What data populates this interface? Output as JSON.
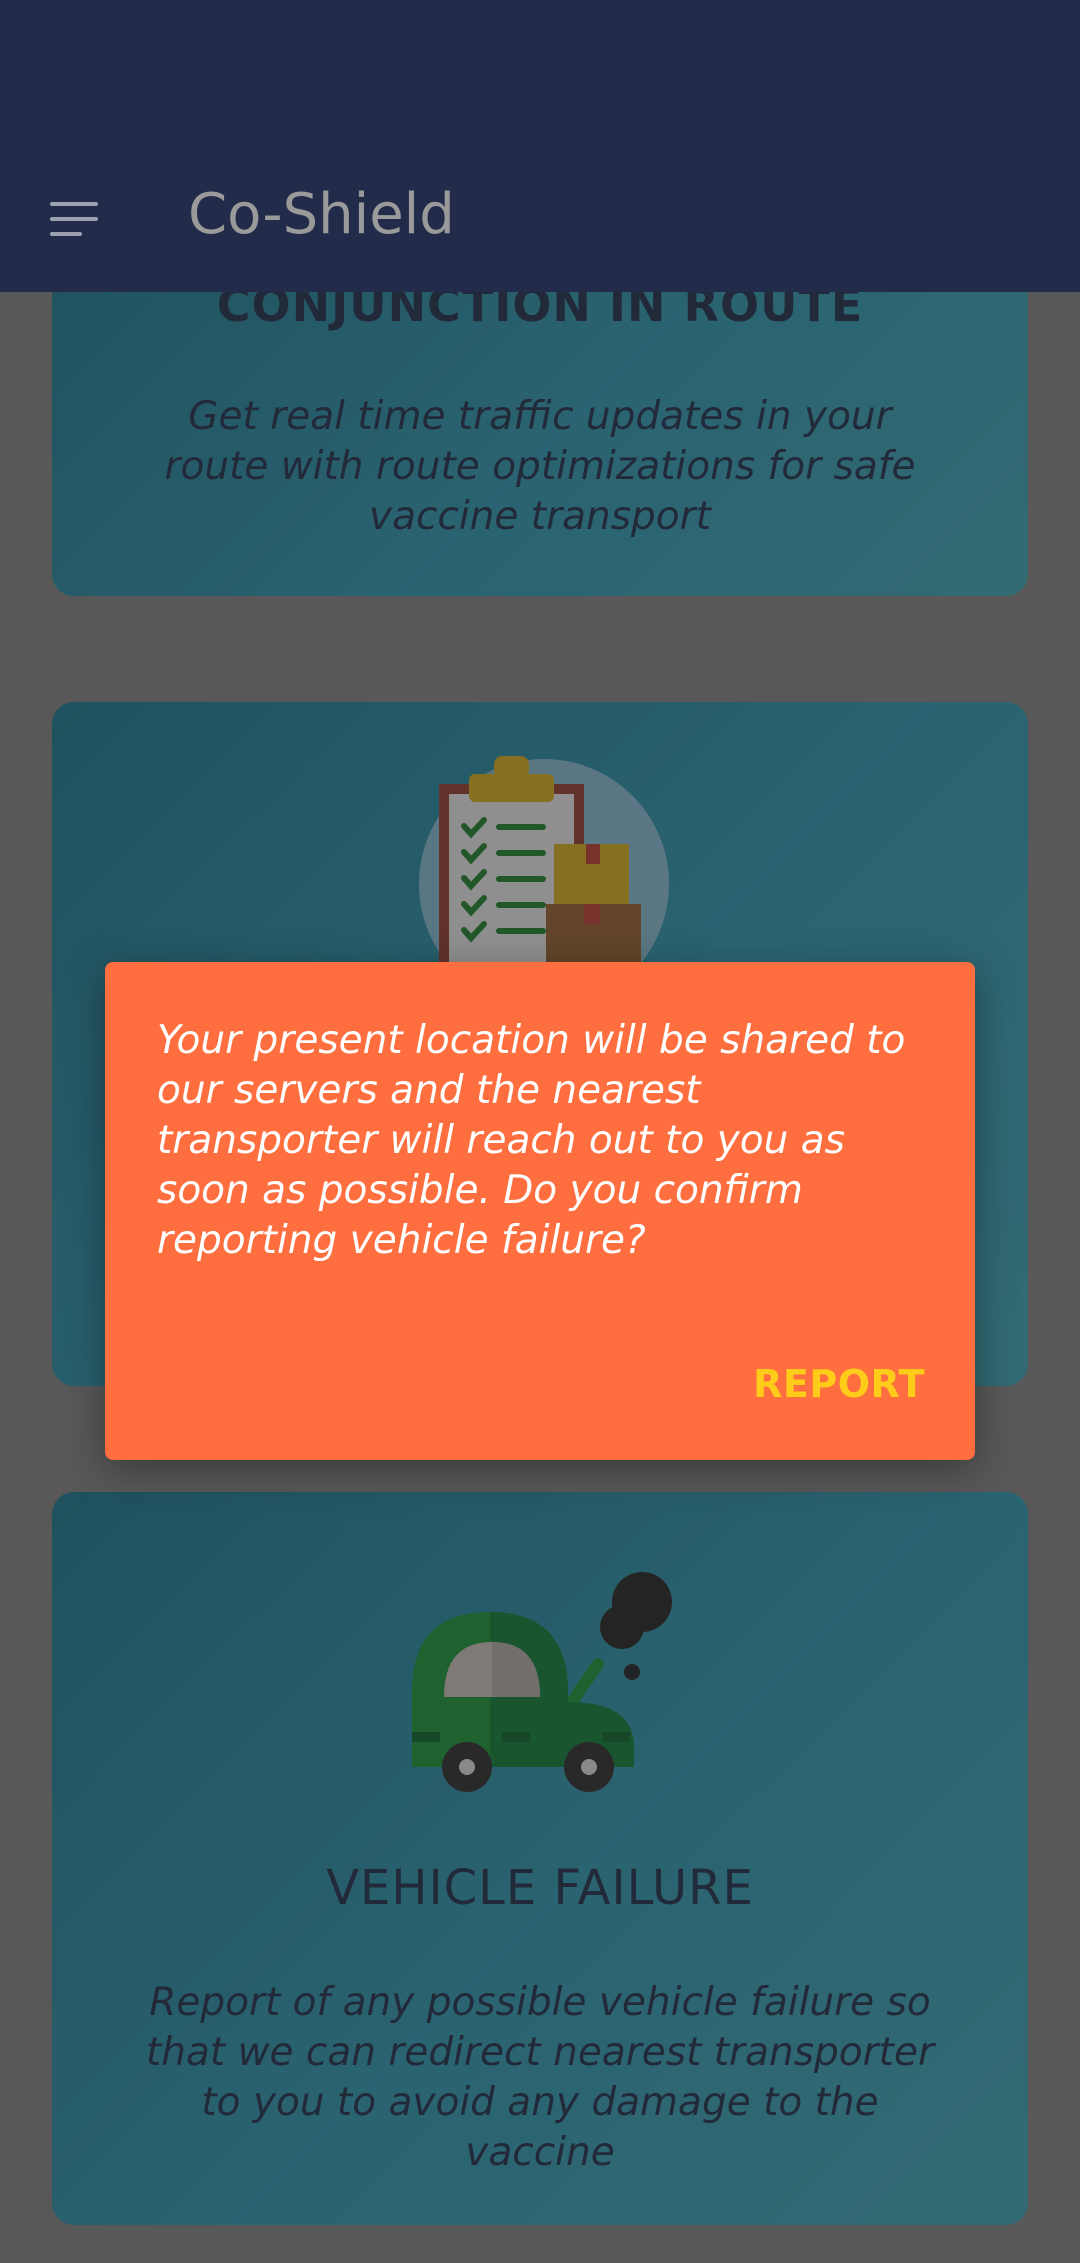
{
  "app_bar": {
    "title": "Co-Shield",
    "menu_icon": "hamburger-menu-icon"
  },
  "cards": [
    {
      "title": "CONJUNCTION IN ROUTE",
      "description": "Get real time traffic updates in your route with route optimizations for safe vaccine transport"
    },
    {
      "illustration": "checklist-boxes-icon"
    },
    {
      "title": "VEHICLE FAILURE",
      "description": "Report of any possible vehicle failure so that we can redirect nearest transporter to you to avoid any damage to the vaccine",
      "illustration": "broken-car-icon"
    }
  ],
  "dialog": {
    "message": "Your present location will be shared to our servers and the nearest transporter will reach out to you as soon as possible. Do you confirm reporting vehicle failure?",
    "action_label": "REPORT"
  },
  "colors": {
    "app_bar": "#232b4b",
    "dialog": "#ff6e3e",
    "dialog_action": "#ffcc1a",
    "card": "#2d8fa6",
    "text_dark": "#1e2a45"
  }
}
